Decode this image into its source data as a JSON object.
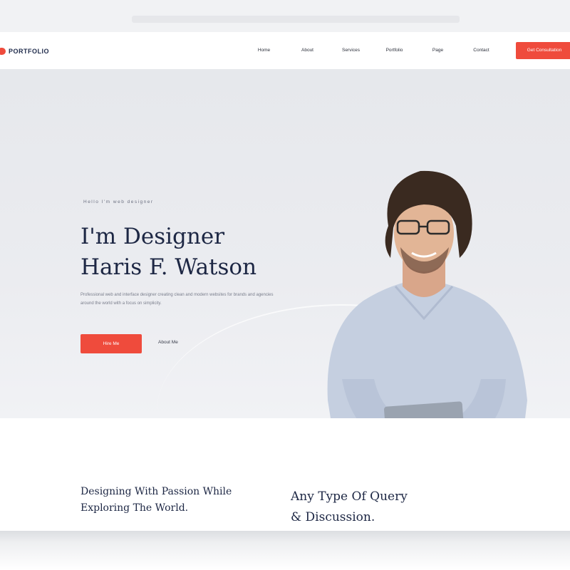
{
  "brand": {
    "name": "PORTFOLIO",
    "accent": "#ef4b3c",
    "heading_color": "#1d2744"
  },
  "nav": {
    "items": [
      "Home",
      "About",
      "Services",
      "Portfolio",
      "Page",
      "Contact"
    ],
    "cta": "Get Consultation"
  },
  "hero": {
    "eyebrow": "Hello I'm web designer",
    "title_line1": "I'm Designer",
    "title_line2": "Haris F. Watson",
    "description": "Professional web and interface designer creating clean and modern websites for brands and agencies around the world with a focus on simplicity.",
    "primary_button": "Hire Me",
    "secondary_link": "About Me"
  },
  "features": {
    "left_line1": "Designing With Passion While",
    "left_line2": "Exploring The World.",
    "right_line1": "Any Type Of Query",
    "right_line2": "& Discussion."
  }
}
